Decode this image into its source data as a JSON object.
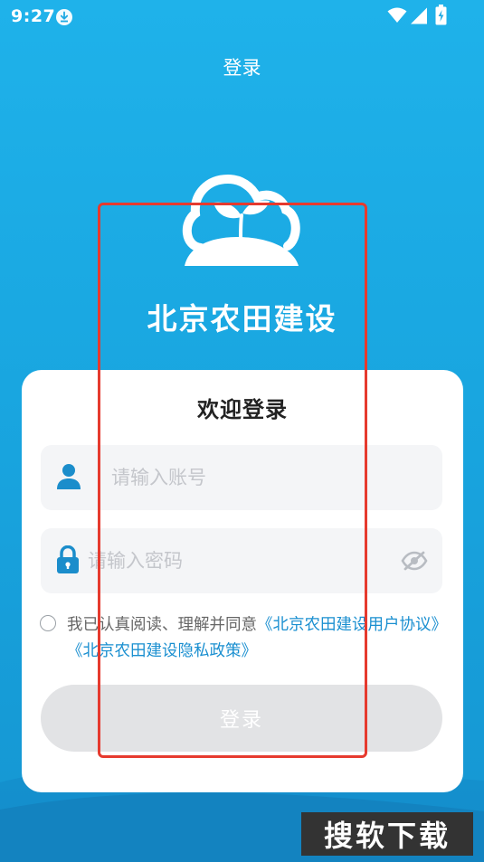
{
  "status_bar": {
    "time": "9:27"
  },
  "header": {
    "title": "登录"
  },
  "app": {
    "name": "北京农田建设"
  },
  "login_card": {
    "welcome": "欢迎登录",
    "account_placeholder": "请输入账号",
    "password_placeholder": "请输入密码",
    "agreement": {
      "prefix": "我已认真阅读、理解并同意",
      "user_agreement_link": "《北京农田建设用户协议》",
      "privacy_policy_link": "《北京农田建设隐私政策》"
    },
    "login_button": "登录"
  },
  "watermark": {
    "text": "搜软下载"
  },
  "colors": {
    "background": "#1fb2ea",
    "link": "#1a8fd0",
    "icon": "#1b8dcb",
    "button_disabled": "#e2e3e5",
    "highlight": "#e63a2e"
  },
  "icons": [
    "download-icon",
    "wifi-icon",
    "signal-icon",
    "battery-icon",
    "cloud-sprout-logo-icon",
    "user-icon",
    "lock-icon",
    "eye-hidden-icon"
  ]
}
